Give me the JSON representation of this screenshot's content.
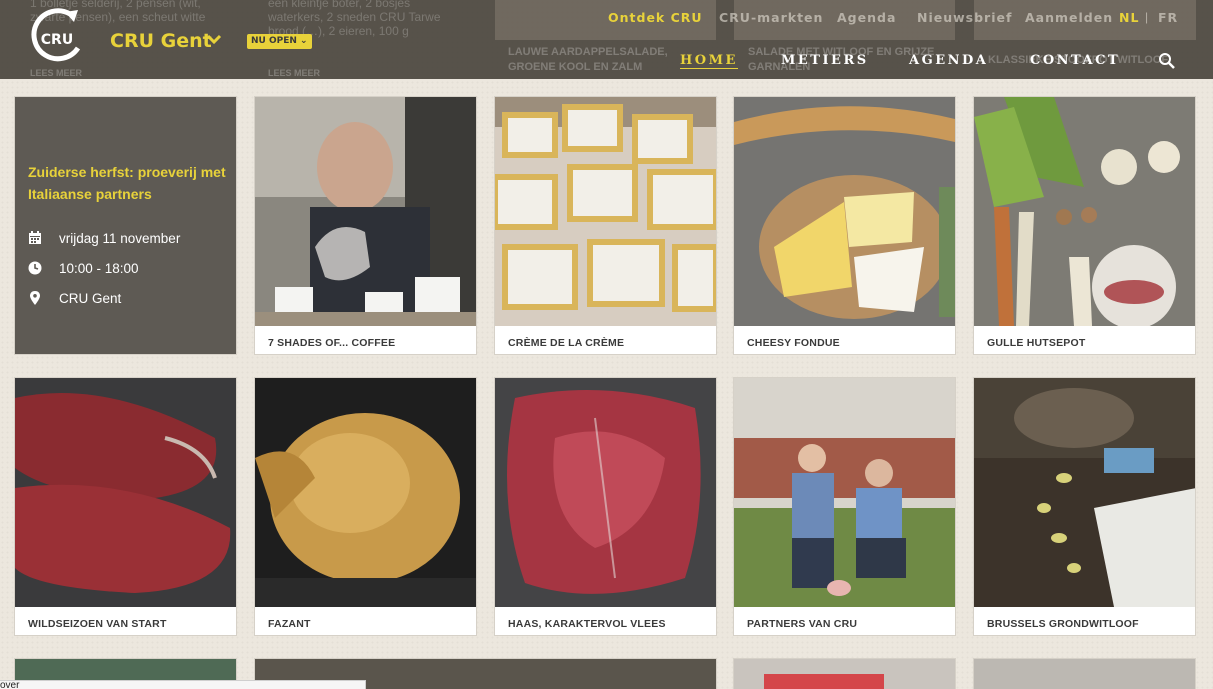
{
  "header": {
    "logo_text": "CRU",
    "city": "CRU Gent",
    "open_badge": "NU OPEN",
    "top_nav": [
      {
        "label": "Ontdek CRU",
        "active": true
      },
      {
        "label": "CRU-markten",
        "active": false
      },
      {
        "label": "Agenda",
        "active": false
      },
      {
        "label": "Nieuwsbrief",
        "active": false
      },
      {
        "label": "Aanmelden",
        "active": false
      }
    ],
    "languages": [
      {
        "label": "NL",
        "active": true
      },
      {
        "label": "FR",
        "active": false
      }
    ],
    "lang_separator": "|",
    "main_nav": [
      {
        "label": "HOME",
        "active": true
      },
      {
        "label": "METIERS",
        "active": false
      },
      {
        "label": "AGENDA",
        "active": false
      },
      {
        "label": "CONTACT",
        "active": false
      }
    ],
    "behind": {
      "card1_text": [
        "1 bolletje selderij, 2 pensen (wit,",
        "zwarte pensen), een scheut witte"
      ],
      "card2_text": [
        "een kleintje boter, 2 bosjes",
        "waterkers, 2 sneden CRU Tarwe",
        "brood (…), 2 eieren, 100 g"
      ],
      "read_more": "LEES MEER",
      "card3_title": [
        "LAUWE AARDAPPELSALADE,",
        "GROENE KOOL EN ZALM"
      ],
      "card4_title": [
        "SALADE MET WITLOOF EN GRIJZE",
        "GARNALEN"
      ],
      "card5_title": "KLASSIEKE STOOFPOT WITLOOF"
    }
  },
  "event": {
    "title": "Zuiderse herfst: proeverij met Italiaanse partners",
    "date": "vrijdag 11 november",
    "time": "10:00 - 18:00",
    "location": "CRU Gent"
  },
  "tiles": [
    {
      "label": "7 SHADES OF... COFFEE",
      "icon": "coffee-photo"
    },
    {
      "label": "CRÈME DE LA CRÈME",
      "icon": "pastry-photo"
    },
    {
      "label": "CHEESY FONDUE",
      "icon": "cheese-photo"
    },
    {
      "label": "GULLE HUTSEPOT",
      "icon": "vegetables-photo"
    },
    {
      "label": "WILDSEIZOEN VAN START",
      "icon": "venison-photo"
    },
    {
      "label": "FAZANT",
      "icon": "pheasant-photo"
    },
    {
      "label": "HAAS, KARAKTERVOL VLEES",
      "icon": "hare-photo"
    },
    {
      "label": "PARTNERS VAN CRU",
      "icon": "farmers-photo"
    },
    {
      "label": "BRUSSELS GRONDWITLOOF",
      "icon": "chicory-photo"
    }
  ],
  "status_bar_text": "over",
  "colors": {
    "accent": "#e8d23a",
    "header_bg": "#4b463e",
    "event_bg": "#5e5a54",
    "page_bg": "#ece7de"
  }
}
